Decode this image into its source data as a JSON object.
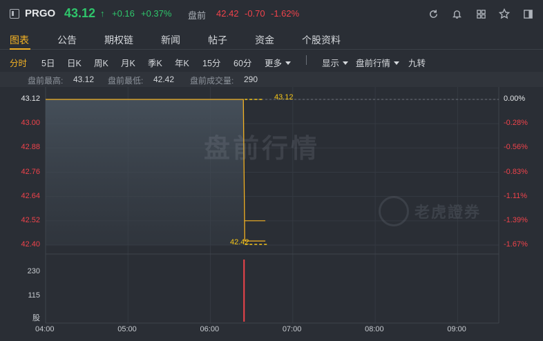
{
  "header": {
    "symbol": "PRGO",
    "price": "43.12",
    "price_arrow": "↑",
    "change": "+0.16",
    "change_pct": "+0.37%",
    "premarket_label": "盘前",
    "premarket_price": "42.42",
    "premarket_change": "-0.70",
    "premarket_change_pct": "-1.62%",
    "icons": [
      "refresh-icon",
      "bell-icon",
      "grid-icon",
      "star-icon",
      "panel-icon"
    ]
  },
  "tabs": [
    {
      "label": "图表",
      "active": true
    },
    {
      "label": "公告"
    },
    {
      "label": "期权链"
    },
    {
      "label": "新闻"
    },
    {
      "label": "帖子"
    },
    {
      "label": "资金"
    },
    {
      "label": "个股资料"
    }
  ],
  "toolbar": {
    "periods": [
      {
        "label": "分时",
        "active": true
      },
      {
        "label": "5日"
      },
      {
        "label": "日K"
      },
      {
        "label": "周K"
      },
      {
        "label": "月K"
      },
      {
        "label": "季K"
      },
      {
        "label": "年K"
      },
      {
        "label": "15分"
      },
      {
        "label": "60分"
      },
      {
        "label": "更多"
      }
    ],
    "display_label": "显示",
    "session_label": "盘前行情",
    "nine_turn_label": "九转"
  },
  "stats": {
    "high_label": "盘前最高:",
    "high_value": "43.12",
    "low_label": "盘前最低:",
    "low_value": "42.42",
    "volume_label": "盘前成交量:",
    "volume_value": "290"
  },
  "watermark": "盘前行情",
  "brand_watermark": "老虎證券",
  "colors": {
    "up": "#2fc56b",
    "down": "#f0434b",
    "accent": "#f5b324",
    "line": "#f5b324",
    "callout": "#f5c518"
  },
  "chart_data": {
    "type": "line",
    "price_axis_labels": [
      "43.12",
      "43.00",
      "42.88",
      "42.76",
      "42.64",
      "42.52",
      "42.40"
    ],
    "price_axis_values": [
      43.12,
      43.0,
      42.88,
      42.76,
      42.64,
      42.52,
      42.4
    ],
    "pct_axis_labels": [
      "0.00%",
      "-0.28%",
      "-0.56%",
      "-0.83%",
      "-1.11%",
      "-1.39%",
      "-1.67%"
    ],
    "volume_axis_labels": [
      "230",
      "115",
      "股"
    ],
    "x_tick_labels": [
      "04:00",
      "05:00",
      "06:00",
      "07:00",
      "08:00",
      "09:00"
    ],
    "x_range": [
      "04:00",
      "09:30"
    ],
    "y_range": [
      42.4,
      43.12
    ],
    "reference_price": 43.12,
    "price_series": [
      {
        "time": "04:00",
        "price": 43.12
      },
      {
        "time": "06:24",
        "price": 43.12
      },
      {
        "time": "06:25",
        "price": 42.42
      },
      {
        "time": "06:40",
        "price": 42.42
      }
    ],
    "avg_series": [
      {
        "time": "06:25",
        "price": 42.52
      },
      {
        "time": "06:40",
        "price": 42.52
      }
    ],
    "volume_series": [
      {
        "time": "06:24",
        "volume": 290
      }
    ],
    "volume_max": 290,
    "high_callout": "43.12",
    "low_callout": "42.42"
  }
}
